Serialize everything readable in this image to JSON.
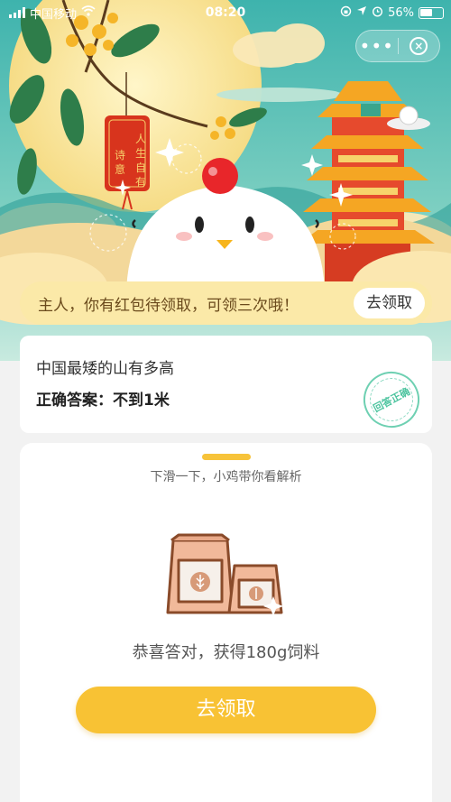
{
  "status_bar": {
    "carrier": "中国移动",
    "time": "08:20",
    "battery": "56%"
  },
  "capsule": {
    "more_label": "•••",
    "close_label": "×"
  },
  "hero": {
    "poem_tag": "人生自有诗意"
  },
  "notice": {
    "text": "主人，你有红包待领取，可领三次哦！",
    "button": "去领取"
  },
  "answer_card": {
    "question": "中国最矮的山有多高",
    "answer_prefix": "正确答案：",
    "answer_value": "不到1米",
    "stamp": "回答正确"
  },
  "sheet": {
    "swipe_hint": "下滑一下，小鸡带你看解析",
    "reward_text": "恭喜答对，获得180g饲料",
    "cta_button": "去领取"
  },
  "colors": {
    "accent": "#f8c234",
    "notice_bg": "#fbe9a8",
    "stamp_green": "#4dc49f",
    "sky": "#5fc3b8"
  }
}
